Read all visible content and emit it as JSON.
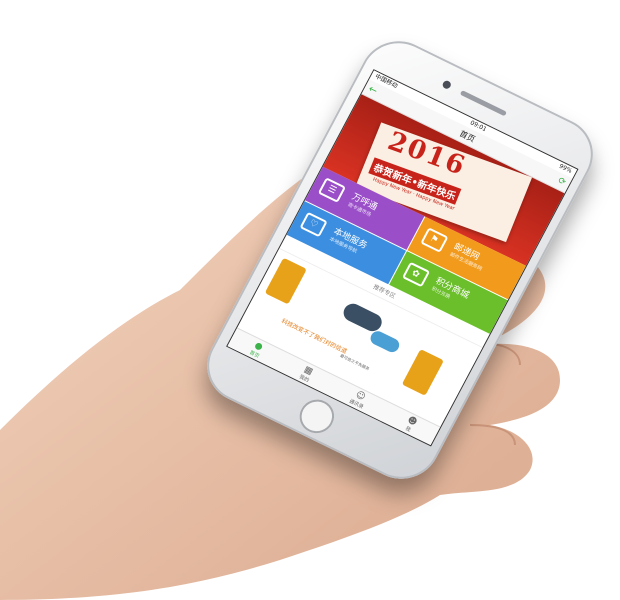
{
  "status": {
    "carrier": "中国移动",
    "time": "09:01",
    "battery": "99%"
  },
  "nav": {
    "title": "首页"
  },
  "banner": {
    "year": "2016",
    "greeting": "恭贺新年•新年快乐",
    "subtitle": "Happy New Year · Happy New Year"
  },
  "tiles": [
    {
      "title": "万呼通",
      "sub": "商卡通市场",
      "color": "#9a4fc9"
    },
    {
      "title": "邮递网",
      "sub": "邮件生活服务网",
      "color": "#f29a1b"
    },
    {
      "title": "本地服务",
      "sub": "本地服务导航",
      "color": "#3c8fe0"
    },
    {
      "title": "积分商城",
      "sub": "积分兑换",
      "color": "#6bbf2b"
    }
  ],
  "recommend": {
    "title": "推荐专区"
  },
  "promo": {
    "slogan": "科技改变不了我们对的信道",
    "slogan2": "最可信之不失服务"
  },
  "tabs": [
    {
      "label": "首页",
      "icon": "home-icon"
    },
    {
      "label": "我的",
      "icon": "grid-icon"
    },
    {
      "label": "通讯录",
      "icon": "contacts-icon"
    },
    {
      "label": "我",
      "icon": "user-icon"
    }
  ]
}
